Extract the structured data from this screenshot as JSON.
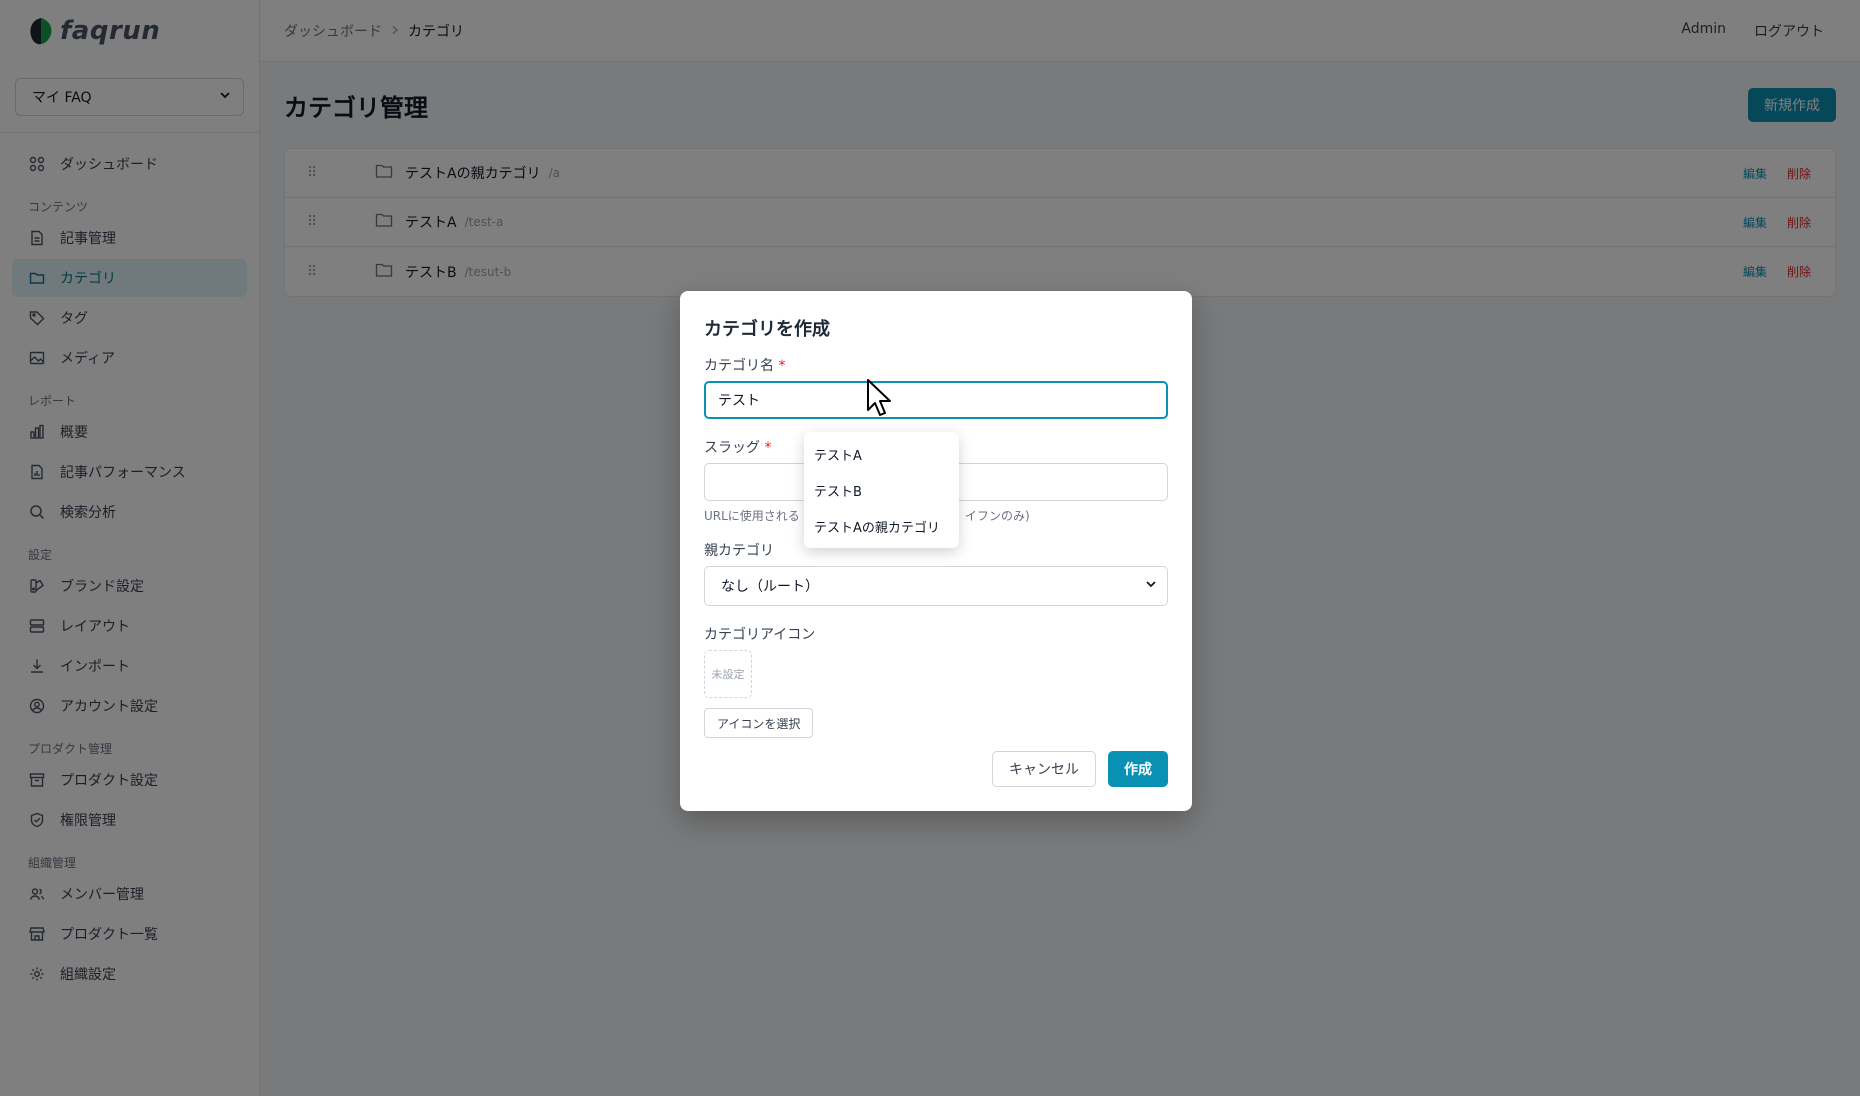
{
  "app": {
    "logo_text": "faqrun"
  },
  "sidebar": {
    "product_select": "マイ FAQ",
    "dashboard": "ダッシュボード",
    "sections": [
      {
        "title": "コンテンツ",
        "items": [
          {
            "label": "記事管理",
            "icon": "document-icon"
          },
          {
            "label": "カテゴリ",
            "icon": "folder-icon",
            "active": true
          },
          {
            "label": "タグ",
            "icon": "tag-icon"
          },
          {
            "label": "メディア",
            "icon": "image-icon"
          }
        ]
      },
      {
        "title": "レポート",
        "items": [
          {
            "label": "概要",
            "icon": "bar-chart-icon"
          },
          {
            "label": "記事パフォーマンス",
            "icon": "document-chart-icon"
          },
          {
            "label": "検索分析",
            "icon": "search-icon"
          }
        ]
      },
      {
        "title": "設定",
        "items": [
          {
            "label": "ブランド設定",
            "icon": "palette-icon"
          },
          {
            "label": "レイアウト",
            "icon": "layout-icon"
          },
          {
            "label": "インポート",
            "icon": "download-icon"
          },
          {
            "label": "アカウント設定",
            "icon": "user-circle-icon"
          }
        ]
      },
      {
        "title": "プロダクト管理",
        "items": [
          {
            "label": "プロダクト設定",
            "icon": "archive-icon"
          },
          {
            "label": "権限管理",
            "icon": "shield-icon"
          }
        ]
      },
      {
        "title": "組織管理",
        "items": [
          {
            "label": "メンバー管理",
            "icon": "users-icon"
          },
          {
            "label": "プロダクト一覧",
            "icon": "store-icon"
          },
          {
            "label": "組織設定",
            "icon": "gear-icon"
          }
        ]
      }
    ]
  },
  "header": {
    "breadcrumb": [
      "ダッシュボード",
      "カテゴリ"
    ],
    "user": "Admin",
    "logout": "ログアウト"
  },
  "main": {
    "title": "カテゴリ管理",
    "new_button": "新規作成",
    "categories": [
      {
        "name": "テストAの親カテゴリ",
        "slug": "/a"
      },
      {
        "name": "テストA",
        "slug": "/test-a"
      },
      {
        "name": "テストB",
        "slug": "/tesut-b"
      }
    ],
    "edit_label": "編集",
    "delete_label": "削除"
  },
  "modal": {
    "title": "カテゴリを作成",
    "name_label": "カテゴリ名",
    "name_value": "テスト",
    "slug_label": "スラッグ",
    "slug_value": "",
    "slug_hint": "URLに使用される識別子（英小文字・数字・ハイフンのみ）",
    "slug_hint_visible": "URLに使用される",
    "slug_hint_tail": "イフンのみ)",
    "parent_label": "親カテゴリ",
    "parent_value": "なし（ルート）",
    "icon_label": "カテゴリアイコン",
    "icon_placeholder": "未設定",
    "icon_button": "アイコンを選択",
    "cancel": "キャンセル",
    "create": "作成",
    "required_mark": "*"
  },
  "autocomplete": [
    "テストA",
    "テストB",
    "テストAの親カテゴリ"
  ],
  "colors": {
    "accent": "#0891b2",
    "danger": "#dc2626",
    "active_bg": "#e0f2f6"
  }
}
